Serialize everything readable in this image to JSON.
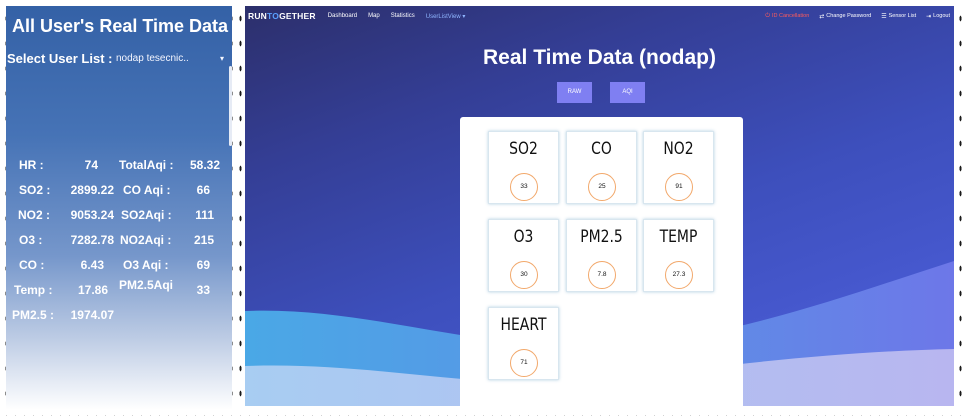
{
  "left_panel": {
    "title": "All User's Real Time Data",
    "select_label": "Select User List :",
    "select_value": "nodap tesecnic..",
    "stats_left": [
      {
        "label": "HR  :",
        "value": "74"
      },
      {
        "label": "SO2 :",
        "value": "2899.22"
      },
      {
        "label": "NO2 :",
        "value": "9053.24"
      },
      {
        "label": "O3  :",
        "value": "7282.78"
      },
      {
        "label": "CO  :",
        "value": "6.43"
      },
      {
        "label": "Temp :",
        "value": "17.86"
      },
      {
        "label": "PM2.5 :",
        "value": "1974.07"
      }
    ],
    "stats_right": [
      {
        "label": "TotalAqi :",
        "value": "58.32"
      },
      {
        "label": "CO  Aqi :",
        "value": "66"
      },
      {
        "label": "SO2Aqi :",
        "value": "111"
      },
      {
        "label": "NO2Aqi :",
        "value": "215"
      },
      {
        "label": "O3  Aqi :",
        "value": "69"
      },
      {
        "label": "PM2.5Aqi",
        "value": "33"
      }
    ]
  },
  "app": {
    "brand_left": "RUN",
    "brand_mid": "TO",
    "brand_right": "GETHER",
    "nav": [
      "Dashboard",
      "Map",
      "Statistics",
      "UserListView ▾"
    ],
    "nav_right": [
      "ID Cancellation",
      "Change Password",
      "Sensor List",
      "Logout"
    ],
    "page_title": "Real Time Data (nodap)",
    "buttons": [
      "RAW",
      "AQI"
    ],
    "tiles": [
      {
        "label": "SO2",
        "value": "33"
      },
      {
        "label": "CO",
        "value": "25"
      },
      {
        "label": "NO2",
        "value": "91"
      },
      {
        "label": "O3",
        "value": "30"
      },
      {
        "label": "PM2.5",
        "value": "7.8"
      },
      {
        "label": "TEMP",
        "value": "27.3"
      },
      {
        "label": "HEART",
        "value": "71"
      }
    ]
  },
  "colors": {
    "accent_button": "#7f7ff2",
    "circle_border": "#f2a86b",
    "logout_red": "#ff5b5b",
    "active_nav": "#8fb6ff"
  },
  "icons": {
    "select_caret": "chevron-down-icon",
    "id_cancellation": "power-icon",
    "change_password": "swap-icon",
    "sensor_list": "list-icon",
    "logout": "logout-icon"
  }
}
